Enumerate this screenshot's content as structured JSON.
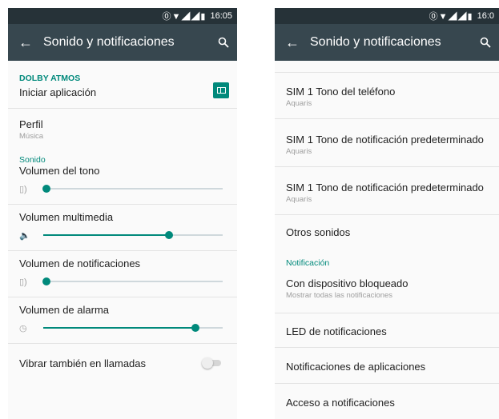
{
  "status_bar": {
    "icons": "⓪▼◢◢▮",
    "time": "16:05"
  },
  "status_bar_right": {
    "icons": "⓪▼◢◢▮",
    "time": "16:0"
  },
  "toolbar": {
    "title": "Sonido y notificaciones"
  },
  "left": {
    "dolby_header": "DOLBY ATMOS",
    "iniciar_label": "Iniciar aplicación",
    "perfil": {
      "title": "Perfil",
      "subtitle": "Música"
    },
    "sonido_header": "Sonido",
    "volumes": [
      {
        "label": "Volumen del tono",
        "icon": "phone-vibrate-icon",
        "level": 0.02
      },
      {
        "label": "Volumen multimedia",
        "icon": "speaker-icon",
        "level": 0.7
      },
      {
        "label": "Volumen de notificaciones",
        "icon": "phone-vibrate-icon",
        "level": 0.02
      },
      {
        "label": "Volumen de alarma",
        "icon": "alarm-clock-icon",
        "level": 0.85
      }
    ],
    "vibrar_label": "Vibrar también en llamadas",
    "vibrar_on": false
  },
  "right": {
    "items": [
      {
        "title": "SIM 1 Tono del teléfono",
        "subtitle": "Aquaris"
      },
      {
        "title": "SIM 1 Tono de notificación predeterminado",
        "subtitle": "Aquaris"
      },
      {
        "title": "SIM 1 Tono de notificación predeterminado",
        "subtitle": "Aquaris"
      }
    ],
    "otros_sonidos": "Otros sonidos",
    "notificacion_header": "Notificación",
    "bloqueado": {
      "title": "Con dispositivo bloqueado",
      "subtitle": "Mostrar todas las notificaciones"
    },
    "led": "LED de notificaciones",
    "apps": "Notificaciones de aplicaciones",
    "acceso": "Acceso a notificaciones"
  },
  "colors": {
    "accent": "#00897b",
    "toolbar": "#37474f",
    "statusbar": "#263238"
  }
}
